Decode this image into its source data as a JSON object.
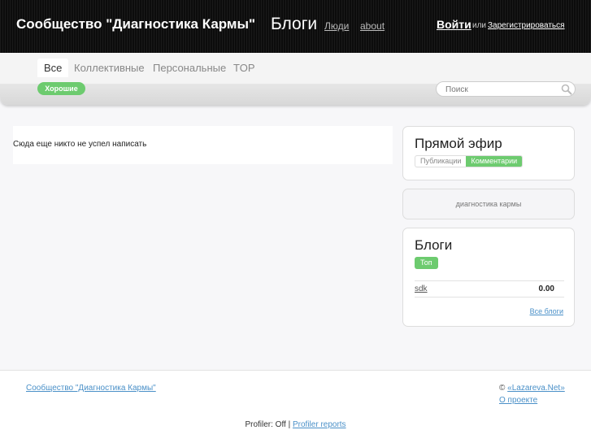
{
  "header": {
    "site_title": "Сообщество \"Диагностика Кармы\"",
    "nav_blogs": "Блоги",
    "nav_people": "Люди",
    "nav_about": "about",
    "login": "Войти",
    "login_or": "или",
    "register": "Зарегистрироваться"
  },
  "subnav": {
    "tabs": [
      {
        "label": "Все"
      },
      {
        "label": "Коллективные"
      },
      {
        "label": "Персональные"
      },
      {
        "label": "TOP"
      }
    ],
    "filter_label": "Хорошие",
    "search_placeholder": "Поиск"
  },
  "main": {
    "empty_message": "Сюда еще никто не успел написать"
  },
  "sidebar": {
    "live": {
      "title": "Прямой эфир",
      "tab_posts": "Публикации",
      "tab_comments": "Комментарии"
    },
    "tag_cloud": {
      "tag": "диагностика кармы"
    },
    "blogs": {
      "title": "Блоги",
      "top_label": "Топ",
      "items": [
        {
          "name": "sdk",
          "rating": "0.00"
        }
      ],
      "all_link": "Все блоги"
    }
  },
  "footer": {
    "left_link": "Сообщество \"Диагностика Кармы\"",
    "copyright_symbol": "©",
    "copyright_link": "«Lazareva.Net»",
    "about_link": "О проекте",
    "profiler_text": "Profiler: Off |",
    "profiler_link": "Profiler reports"
  },
  "colors": {
    "accent_green": "#6dcb6f",
    "link_blue": "#4a90c8",
    "header_bg": "#111111"
  }
}
